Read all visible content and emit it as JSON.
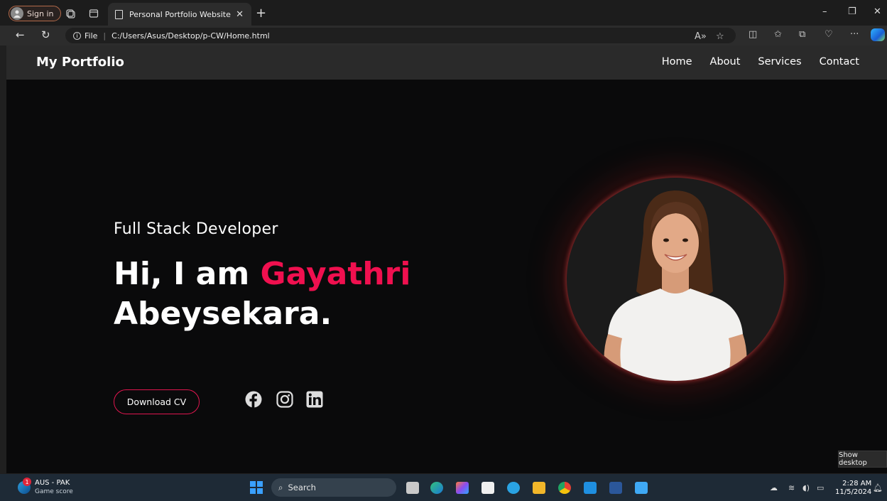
{
  "browser": {
    "signin_label": "Sign in",
    "tab_title": "Personal Portfolio Website",
    "url_scheme_label": "File",
    "url": "C:/Users/Asus/Desktop/p-CW/Home.html"
  },
  "site": {
    "logo": "My Portfolio",
    "nav": [
      "Home",
      "About",
      "Services",
      "Contact"
    ],
    "subtitle": "Full Stack Developer",
    "greeting": "Hi, I am",
    "first_name": "Gayathri",
    "last_name": "Abeysekara.",
    "cta_label": "Download CV",
    "accent_color": "#f0104f",
    "social_icons": [
      "facebook-icon",
      "instagram-icon",
      "linkedin-icon"
    ]
  },
  "desktop": {
    "tooltip": "Show desktop",
    "weather_title": "AUS - PAK",
    "weather_sub": "Game score",
    "weather_badge": "1",
    "search_label": "Search",
    "time": "2:28 AM",
    "date": "11/5/2024"
  }
}
